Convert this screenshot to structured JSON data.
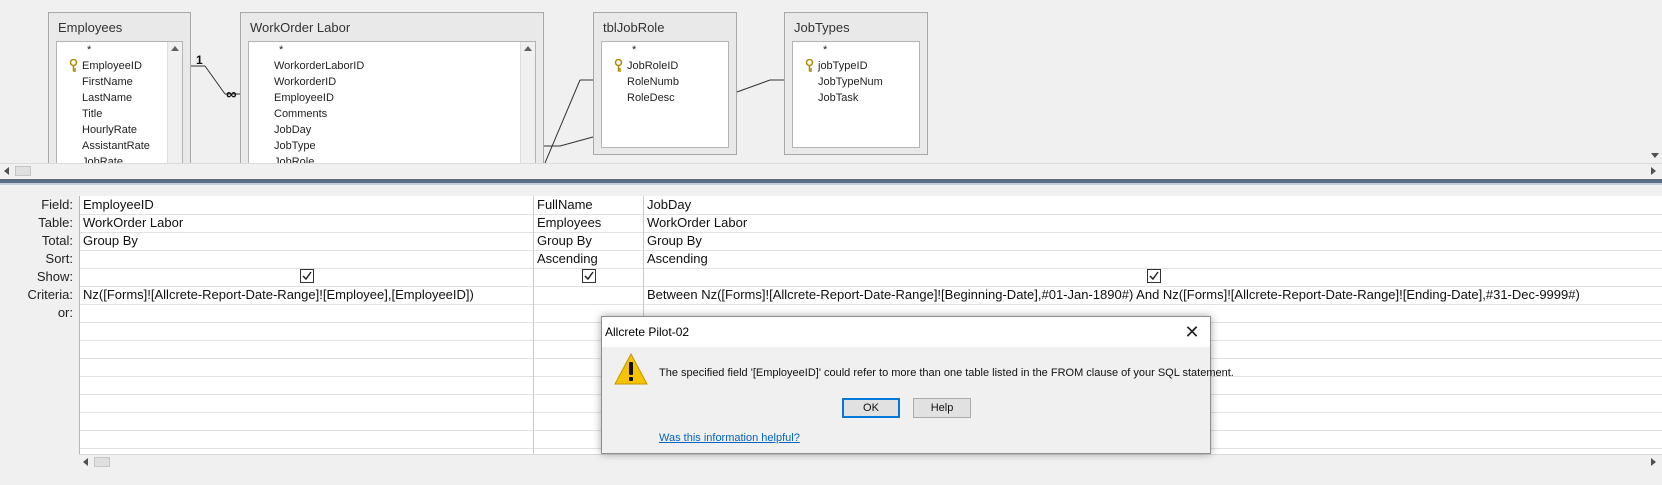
{
  "design_tables": [
    {
      "title": "Employees",
      "fields": [
        "*",
        "EmployeeID",
        "FirstName",
        "LastName",
        "Title",
        "HourlyRate",
        "AssistantRate",
        "JobRate"
      ],
      "key_index": 1
    },
    {
      "title": "WorkOrder Labor",
      "fields": [
        "*",
        "WorkorderLaborID",
        "WorkorderID",
        "EmployeeID",
        "Comments",
        "JobDay",
        "JobType",
        "JobRole"
      ],
      "key_index": -1
    },
    {
      "title": "tblJobRole",
      "fields": [
        "*",
        "JobRoleID",
        "RoleNumb",
        "RoleDesc"
      ],
      "key_index": 1
    },
    {
      "title": "JobTypes",
      "fields": [
        "*",
        "jobTypeID",
        "JobTypeNum",
        "JobTask"
      ],
      "key_index": 1
    }
  ],
  "relationship": {
    "one_label": "1",
    "many_label": "∞"
  },
  "grid": {
    "row_labels": [
      "Field:",
      "Table:",
      "Total:",
      "Sort:",
      "Show:",
      "Criteria:",
      "or:"
    ],
    "columns": [
      {
        "field": "EmployeeID",
        "table": "WorkOrder Labor",
        "total": "Group By",
        "sort": "",
        "show": true,
        "criteria": "Nz([Forms]![Allcrete-Report-Date-Range]![Employee],[EmployeeID])",
        "or": ""
      },
      {
        "field": "FullName",
        "table": "Employees",
        "total": "Group By",
        "sort": "Ascending",
        "show": true,
        "criteria": "",
        "or": ""
      },
      {
        "field": "JobDay",
        "table": "WorkOrder Labor",
        "total": "Group By",
        "sort": "Ascending",
        "show": true,
        "criteria": "Between Nz([Forms]![Allcrete-Report-Date-Range]![Beginning-Date],#01-Jan-1890#) And Nz([Forms]![Allcrete-Report-Date-Range]![Ending-Date],#31-Dec-9999#)",
        "or": ""
      }
    ]
  },
  "dialog": {
    "title": "Allcrete Pilot-02",
    "close_glyph": "✕",
    "message": "The specified field '[EmployeeID]' could refer to more than one table listed in the FROM clause of your SQL statement.",
    "ok_label": "OK",
    "help_label": "Help",
    "link_text": "Was this information helpful?",
    "icon": "warning-icon"
  },
  "colors": {
    "splitter": "#5a6c82",
    "default_button_border": "#0078d7",
    "link": "#0563c1",
    "warning": "#f6c300"
  }
}
